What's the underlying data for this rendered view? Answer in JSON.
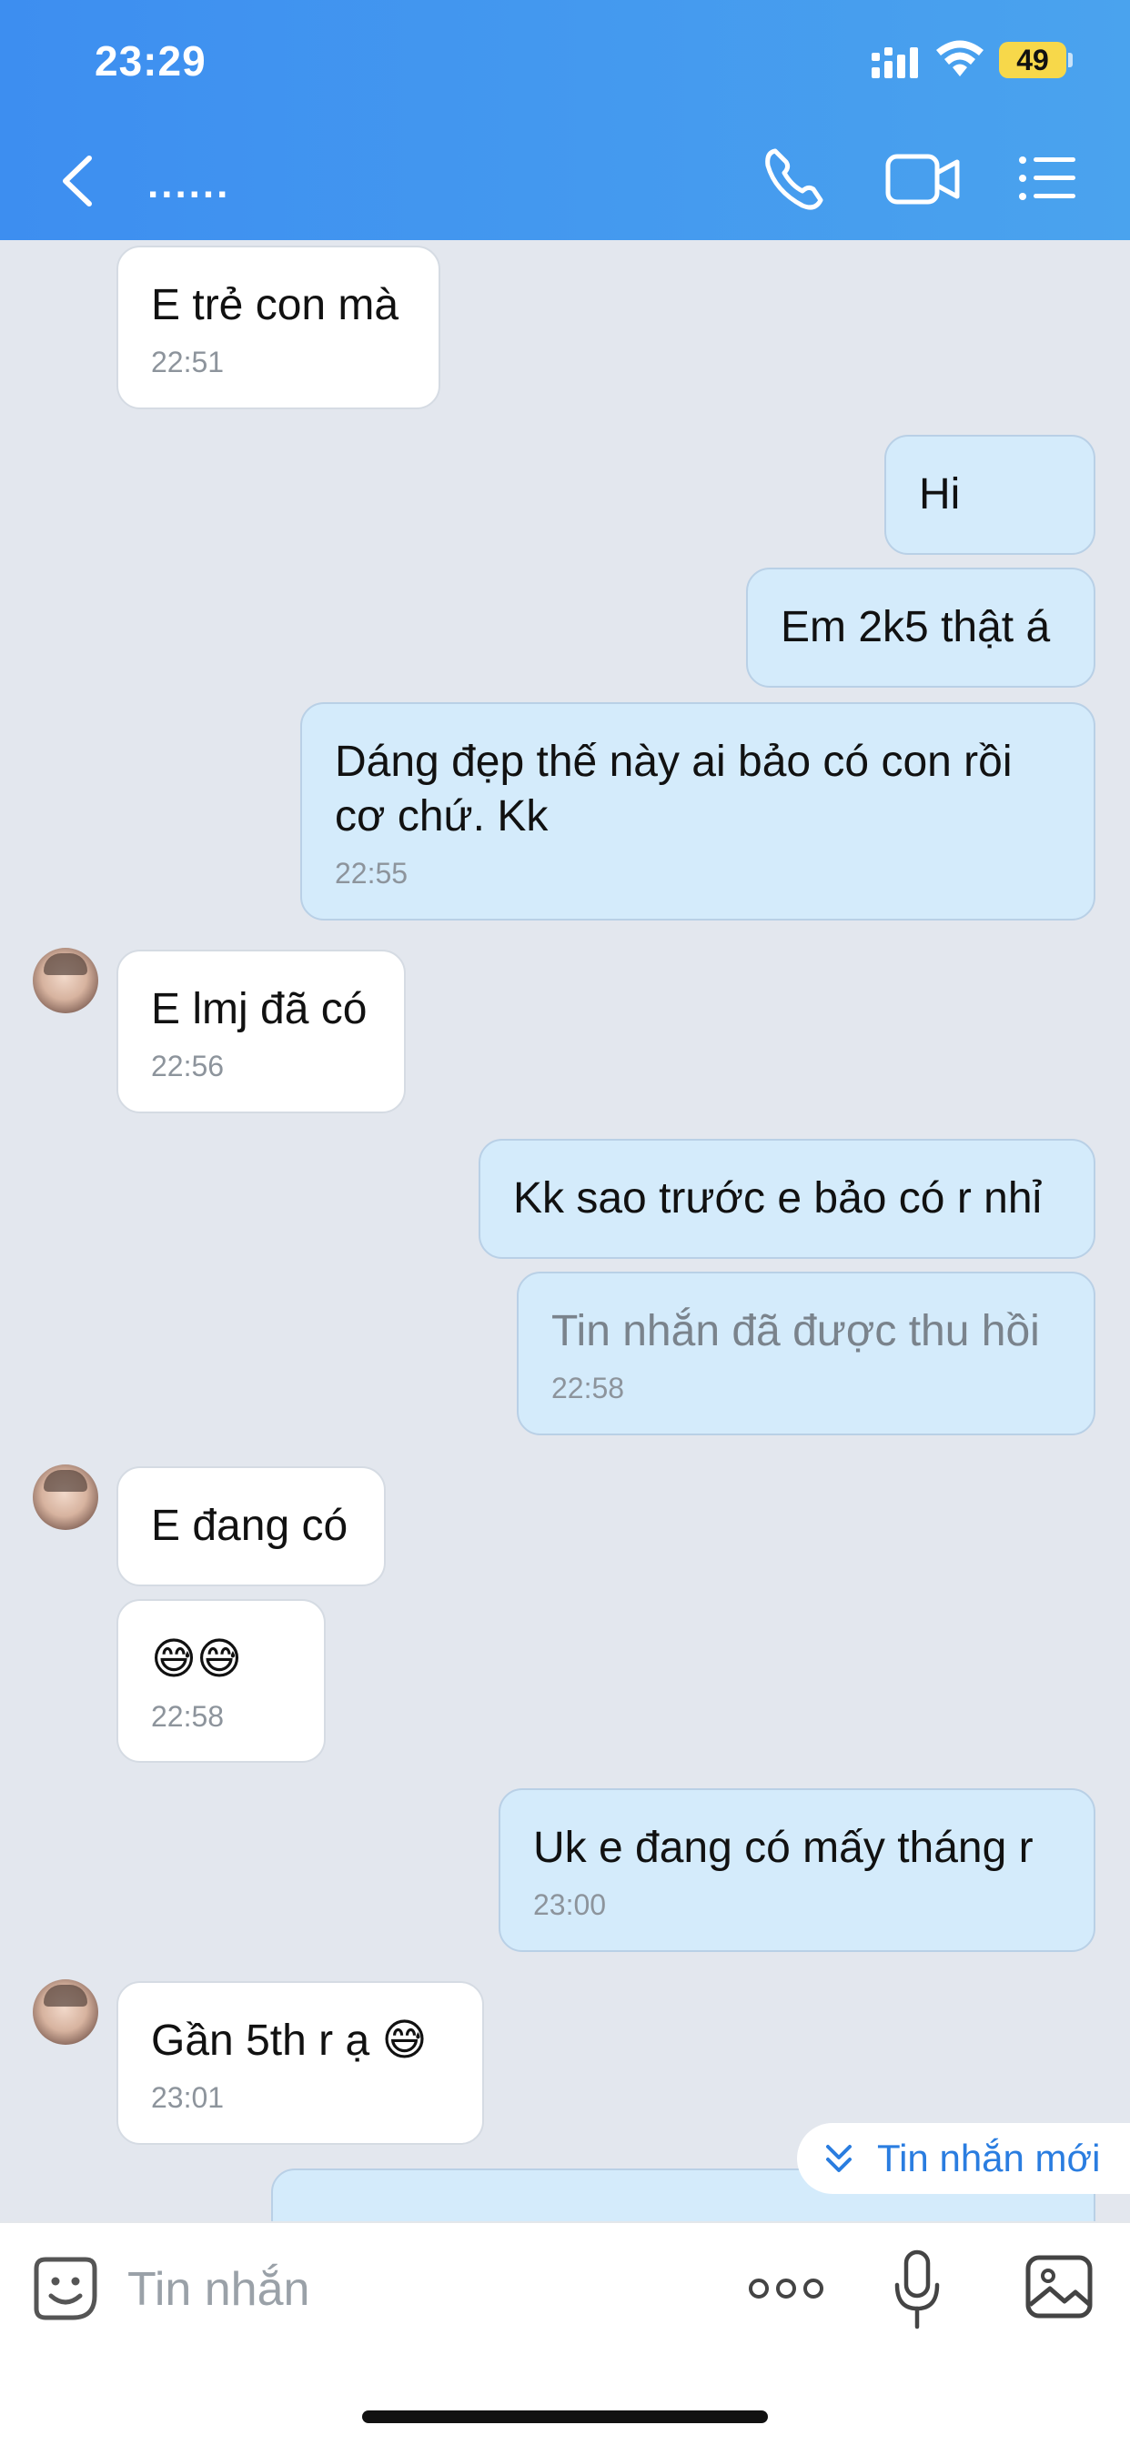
{
  "status_bar": {
    "time": "23:29",
    "battery": "49"
  },
  "header": {
    "title": "......"
  },
  "messages": [
    {
      "text": "E trẻ con mà",
      "time": "22:51"
    },
    {
      "text": "Hi"
    },
    {
      "text": "Em 2k5 thật á"
    },
    {
      "text": "Dáng đẹp thế này ai bảo có con rồi cơ chứ. Kk",
      "time": "22:55"
    },
    {
      "text": "E lmj đã có",
      "time": "22:56"
    },
    {
      "text": "Kk sao trước e bảo có r nhỉ"
    },
    {
      "text": "Tin nhắn đã được thu hồi",
      "time": "22:58"
    },
    {
      "text": "E đang có"
    },
    {
      "text": "😅😅",
      "time": "22:58"
    },
    {
      "text": "Uk e đang có mấy tháng r",
      "time": "23:00"
    },
    {
      "text": "Gần 5th r ạ 😅",
      "time": "23:01"
    }
  ],
  "new_messages_label": "Tin nhắn mới",
  "input": {
    "placeholder": "Tin nhắn"
  }
}
